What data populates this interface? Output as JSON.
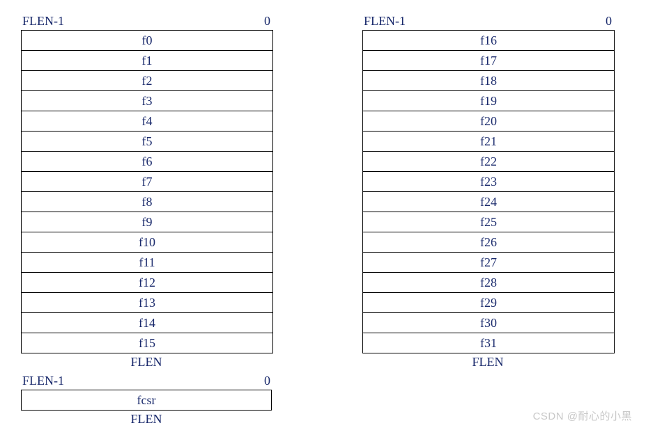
{
  "labels": {
    "msb": "FLEN-1",
    "lsb": "0",
    "width": "FLEN"
  },
  "left_registers": [
    "f0",
    "f1",
    "f2",
    "f3",
    "f4",
    "f5",
    "f6",
    "f7",
    "f8",
    "f9",
    "f10",
    "f11",
    "f12",
    "f13",
    "f14",
    "f15"
  ],
  "right_registers": [
    "f16",
    "f17",
    "f18",
    "f19",
    "f20",
    "f21",
    "f22",
    "f23",
    "f24",
    "f25",
    "f26",
    "f27",
    "f28",
    "f29",
    "f30",
    "f31"
  ],
  "csr": {
    "name": "fcsr"
  },
  "watermark": "CSDN @耐心的小黑"
}
